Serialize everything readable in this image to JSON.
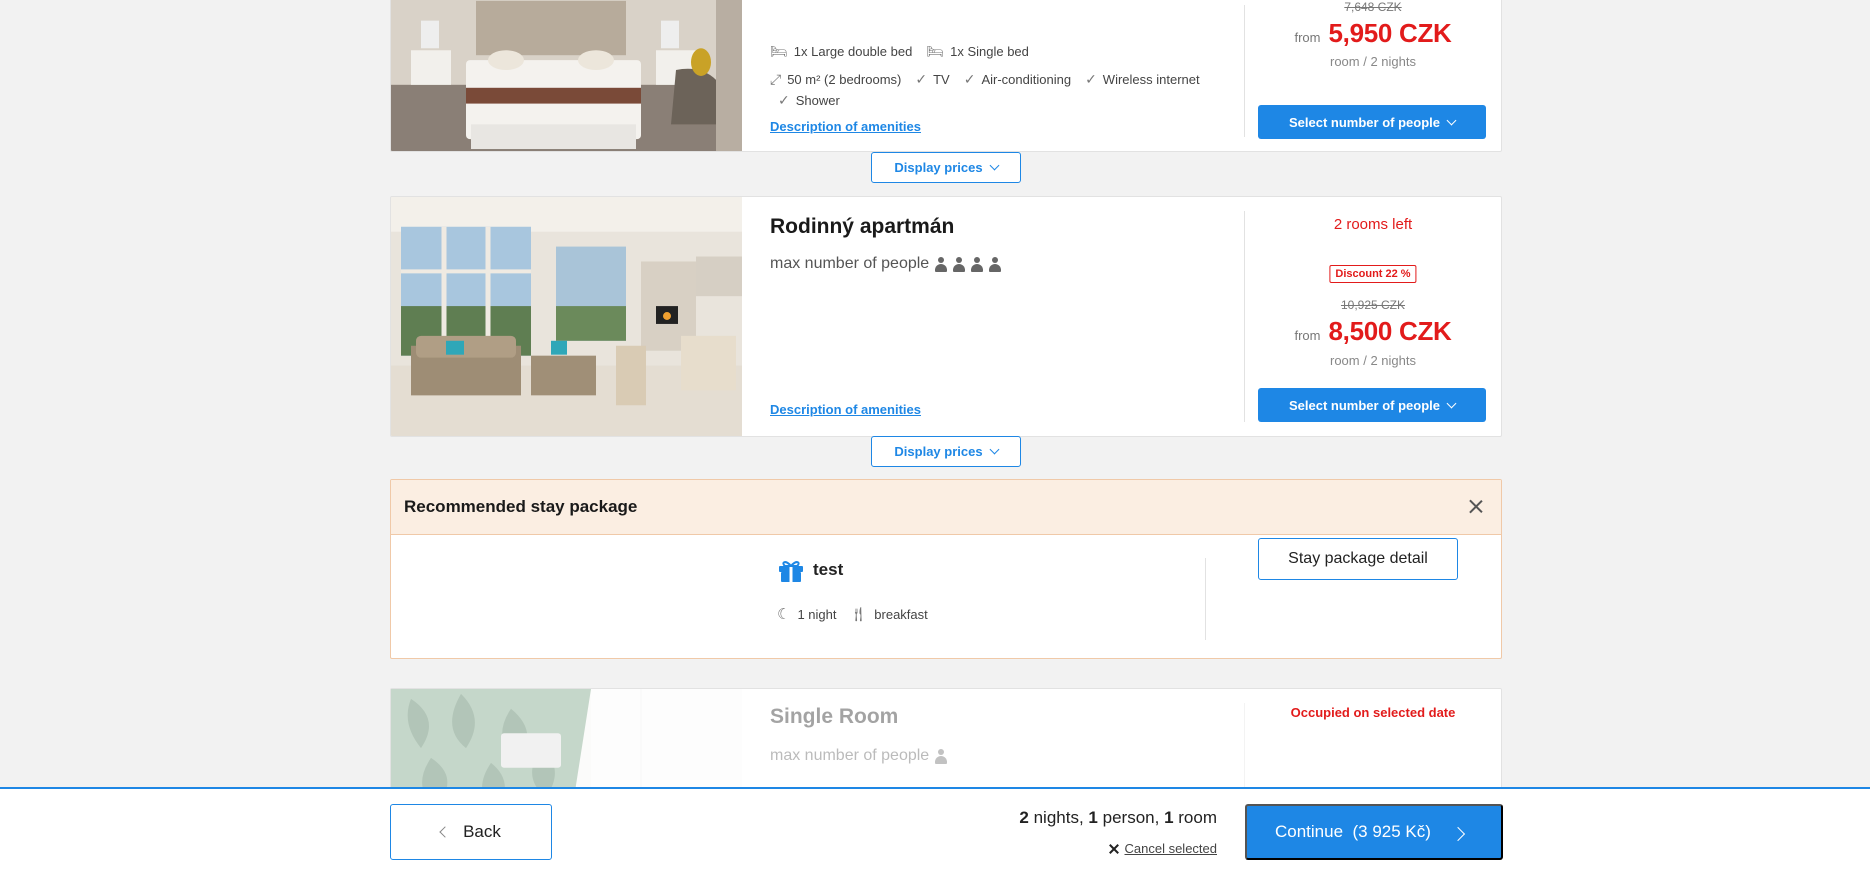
{
  "room_top": {
    "beds": [
      {
        "icon": "bed-icon",
        "label": "1x Large double bed"
      },
      {
        "icon": "bed-icon",
        "label": "1x Single bed"
      }
    ],
    "size": "50 m² (2 bedrooms)",
    "amenities": [
      "TV",
      "Air-conditioning",
      "Wireless internet",
      "Shower"
    ],
    "amenities_link": "Description of amenities",
    "old_price": "7,648 CZK",
    "from": "from",
    "price": "5,950 CZK",
    "per": "room / 2 nights",
    "select_label": "Select number of people",
    "display_prices": "Display prices"
  },
  "room_family": {
    "title": "Rodinný apartmán",
    "people_label": "max number of people",
    "max_people": 4,
    "rooms_left": "2 rooms left",
    "discount": "Discount 22 %",
    "old_price": "10,925 CZK",
    "from": "from",
    "price": "8,500 CZK",
    "per": "room / 2 nights",
    "amenities_link": "Description of amenities",
    "select_label": "Select number of people",
    "display_prices": "Display prices"
  },
  "package": {
    "heading": "Recommended stay package",
    "name": "test",
    "nights": "1 night",
    "board": "breakfast",
    "detail_button": "Stay package detail"
  },
  "room_single": {
    "title": "Single Room",
    "people_label": "max number of people",
    "max_people": 1,
    "status": "Occupied on selected date"
  },
  "footer": {
    "back_label": "Back",
    "nights_count": "2",
    "nights_word": "nights,",
    "person_count": "1",
    "person_word": "person,",
    "room_count": "1",
    "room_word": "room",
    "cancel_label": "Cancel selected",
    "continue_label": "Continue  (3 925 Kč)"
  },
  "colors": {
    "accent": "#1e87e5",
    "price_red": "#e21b1b",
    "package_bg": "#fbeee2"
  }
}
